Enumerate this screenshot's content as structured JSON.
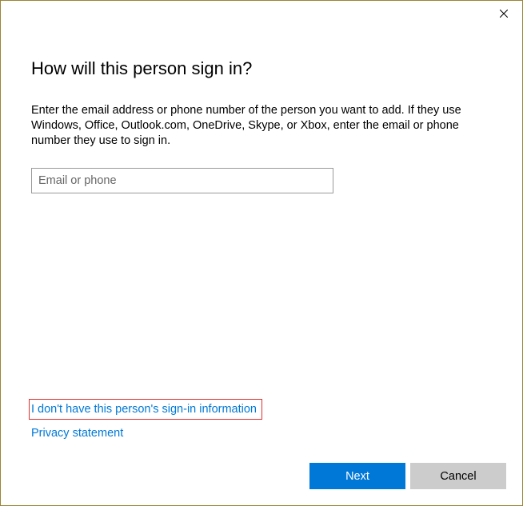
{
  "dialog": {
    "heading": "How will this person sign in?",
    "description": "Enter the email address or phone number of the person you want to add. If they use Windows, Office, Outlook.com, OneDrive, Skype, or Xbox, enter the email or phone number they use to sign in.",
    "input_placeholder": "Email or phone",
    "input_value": "",
    "no_info_link": "I don't have this person's sign-in information",
    "privacy_link": "Privacy statement",
    "next_button": "Next",
    "cancel_button": "Cancel"
  }
}
